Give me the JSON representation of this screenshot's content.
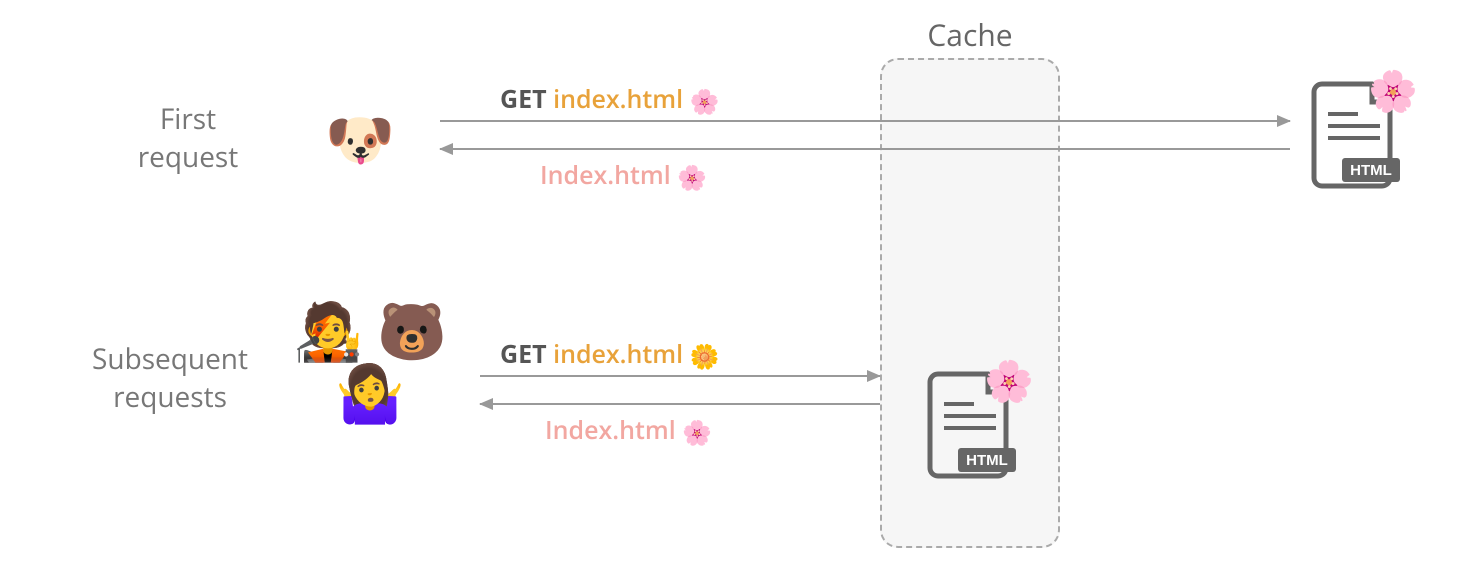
{
  "cache_label": "Cache",
  "rows": {
    "first": {
      "label": "First\nrequest",
      "client_emojis": "🐶",
      "request": {
        "method": "GET",
        "file": "index.html",
        "flower": "🌸"
      },
      "response": {
        "file": "Index.html",
        "flower": "🌸"
      }
    },
    "subsequent": {
      "label": "Subsequent\nrequests",
      "client_emojis": "🧑‍🎤 🐻\n🤷‍♀️",
      "request": {
        "method": "GET",
        "file": "index.html",
        "flower": "🌼"
      },
      "response": {
        "file": "Index.html",
        "flower": "🌸"
      }
    }
  },
  "server_doc": {
    "badge": "HTML",
    "flower": "🌸"
  },
  "cache_doc": {
    "badge": "HTML",
    "flower": "🌸"
  }
}
